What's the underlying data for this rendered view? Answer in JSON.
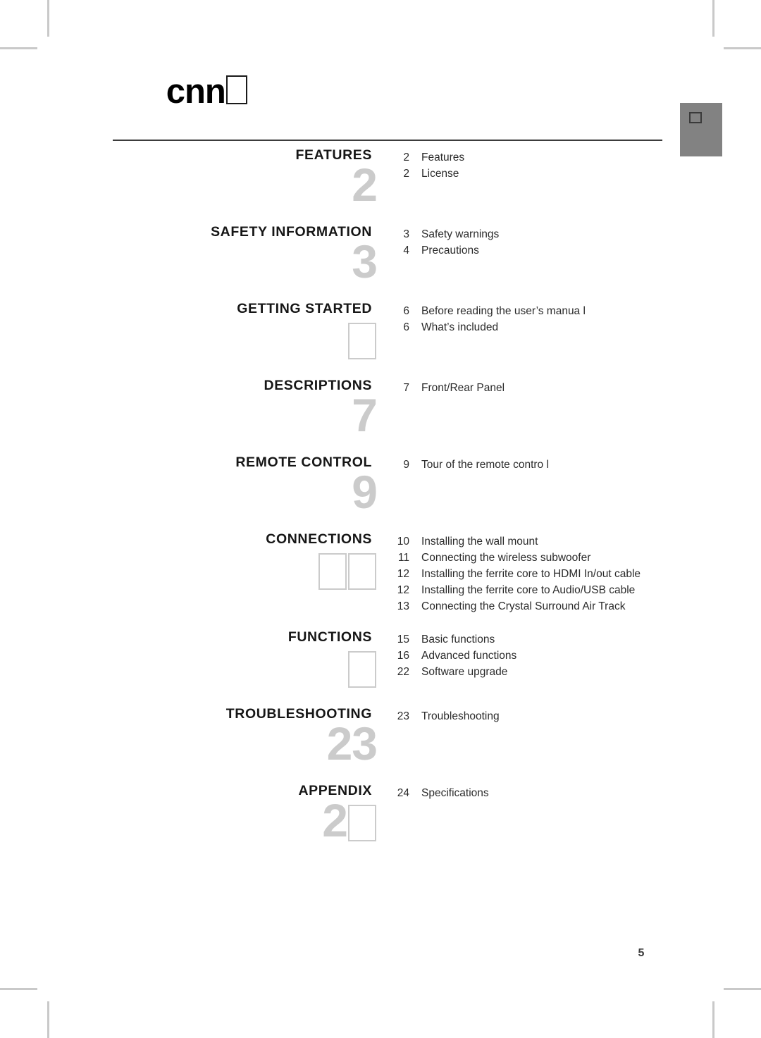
{
  "document": {
    "header_title_prefix": "cnn",
    "header_title_missing_glyphs": 1,
    "page_number": "5",
    "accent_gray": "#828282",
    "bignum_color": "#cbcbcb",
    "rule_color": "#3c3c3c"
  },
  "corner_badge": {
    "glyph": "missing-glyph-box"
  },
  "toc": {
    "sections": [
      {
        "label": "FEATURES",
        "bignum": "2",
        "bignum_tofu_suffix": 0,
        "entries": [
          {
            "page": "2",
            "title": "Features"
          },
          {
            "page": "2",
            "title": "License"
          }
        ]
      },
      {
        "label": "SAFETY INFORMATION",
        "bignum": "3",
        "bignum_tofu_suffix": 0,
        "entries": [
          {
            "page": "3",
            "title": "Safety warnings"
          },
          {
            "page": "4",
            "title": "Precautions"
          }
        ]
      },
      {
        "label": "GETTING STARTED",
        "bignum": "",
        "bignum_tofu_suffix": 1,
        "entries": [
          {
            "page": "6",
            "title": "Before reading the user’s manua l"
          },
          {
            "page": "6",
            "title": "What’s included"
          }
        ]
      },
      {
        "label": "DESCRIPTIONS",
        "bignum": "7",
        "bignum_tofu_suffix": 0,
        "entries": [
          {
            "page": "7",
            "title": "Front/Rear Panel"
          }
        ]
      },
      {
        "label": "REMOTE CONTROL",
        "bignum": "9",
        "bignum_tofu_suffix": 0,
        "entries": [
          {
            "page": "9",
            "title": "Tour of the remote contro l"
          }
        ]
      },
      {
        "label": "CONNECTIONS",
        "bignum": "",
        "bignum_tofu_suffix": 2,
        "entries": [
          {
            "page": "10",
            "title": "Installing the wall mount"
          },
          {
            "page": "11",
            "title": "Connecting the wireless subwoofer"
          },
          {
            "page": "12",
            "title": "Installing the ferrite core to HDMI In/out cable"
          },
          {
            "page": "12",
            "title": "Installing the ferrite core to Audio/USB cable"
          },
          {
            "page": "13",
            "title": "Connecting the Crystal Surround Air Track"
          }
        ]
      },
      {
        "label": "FUNCTIONS",
        "bignum": "",
        "bignum_tofu_suffix": 1,
        "entries": [
          {
            "page": "15",
            "title": "Basic functions"
          },
          {
            "page": "16",
            "title": "Advanced functions"
          },
          {
            "page": "22",
            "title": "Software upgrade"
          }
        ]
      },
      {
        "label": "TROUBLESHOOTING",
        "bignum": "23",
        "bignum_tofu_suffix": 0,
        "entries": [
          {
            "page": "23",
            "title": "Troubleshooting"
          }
        ]
      },
      {
        "label": "APPENDIX",
        "bignum": "2",
        "bignum_tofu_suffix": 1,
        "entries": [
          {
            "page": "24",
            "title": "Specifications"
          }
        ]
      }
    ]
  }
}
